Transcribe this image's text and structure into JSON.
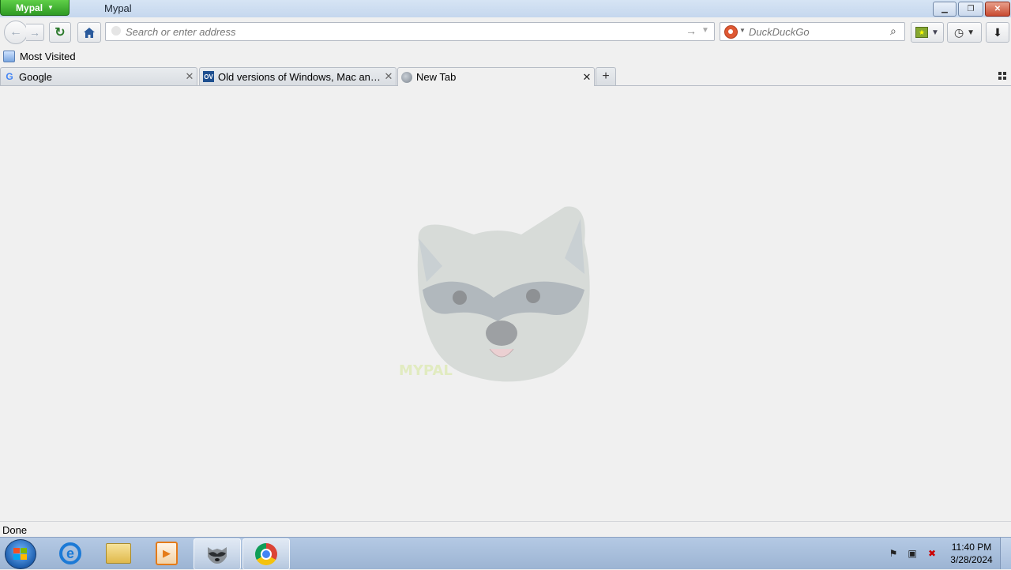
{
  "window": {
    "app_menu_label": "Mypal",
    "title": "Mypal"
  },
  "navbar": {
    "url_placeholder": "Search or enter address",
    "search_placeholder": "DuckDuckGo"
  },
  "bookmarks_bar": {
    "items": [
      {
        "label": "Most Visited",
        "icon": "bookmarks-folder-icon"
      }
    ]
  },
  "tabs": [
    {
      "label": "Google",
      "icon": "google-icon",
      "active": false
    },
    {
      "label": "Old versions of Windows, Mac and Li...",
      "icon": "ov-icon",
      "active": false
    },
    {
      "label": "New Tab",
      "icon": "globe-icon",
      "active": true
    }
  ],
  "content": {
    "logo": "mypal-raccoon-logo",
    "logo_text": "MYPAL"
  },
  "status": {
    "text": "Done"
  },
  "taskbar": {
    "items": [
      "internet-explorer-icon",
      "file-explorer-icon",
      "media-player-icon",
      "mypal-icon",
      "chrome-icon"
    ],
    "clock": {
      "time": "11:40 PM",
      "date": "3/28/2024"
    }
  },
  "colors": {
    "app_menu_green": "#2e9a24",
    "titlebar": "#c5d7ee",
    "taskbar": "#9cb4d3"
  }
}
